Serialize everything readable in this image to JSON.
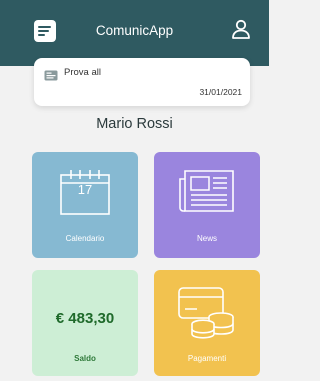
{
  "header": {
    "title": "ComunicApp"
  },
  "notice": {
    "title": "Prova all",
    "date": "31/01/2021"
  },
  "user": {
    "name": "Mario Rossi"
  },
  "tiles": {
    "calendario": {
      "label": "Calendario",
      "day": "17"
    },
    "news": {
      "label": "News"
    },
    "saldo": {
      "label": "Saldo",
      "amount": "€ 483,30"
    },
    "pagamenti": {
      "label": "Pagamenti"
    }
  },
  "colors": {
    "header": "#2f5a61",
    "calendario": "#86b9d2",
    "news": "#9a85de",
    "saldo": "#cdeed5",
    "pagamenti": "#f2c24f"
  },
  "icons": {
    "menu": "menu-icon",
    "user": "user-icon",
    "notice": "notice-icon",
    "calendario": "calendar-icon",
    "news": "newspaper-icon",
    "pagamenti": "payment-icon"
  }
}
